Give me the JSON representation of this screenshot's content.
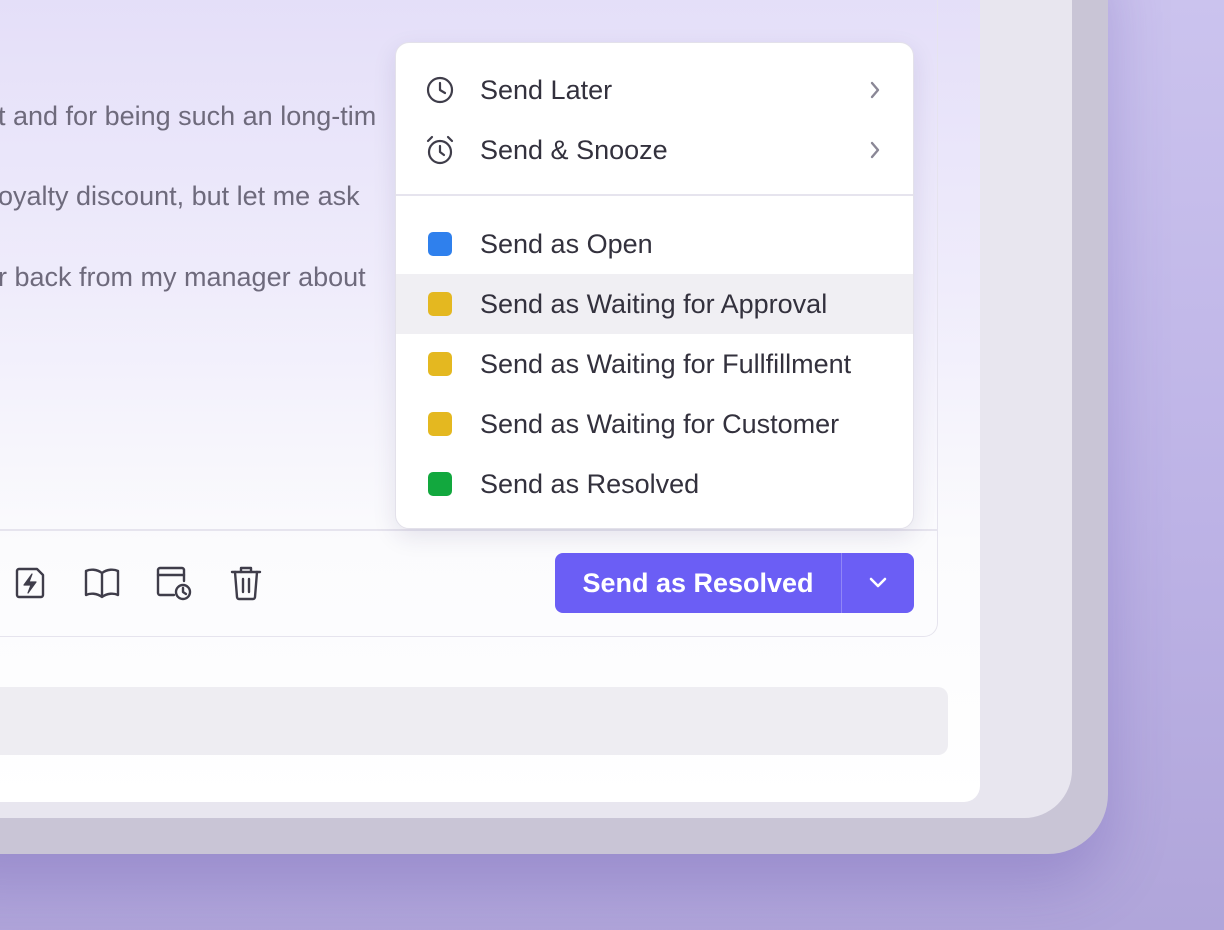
{
  "message": {
    "lines": [
      "t and for being such an long-tim",
      "oyalty discount, but let me ask",
      "r back from my manager about"
    ]
  },
  "toolbar": {
    "icons": [
      "lightning-snippet-icon",
      "knowledge-book-icon",
      "schedule-calendar-icon",
      "trash-icon"
    ]
  },
  "send_button": {
    "label": "Send as Resolved",
    "color": "#6b5ef5"
  },
  "dropdown": {
    "actions": [
      {
        "label": "Send Later",
        "icon": "clock-icon"
      },
      {
        "label": "Send & Snooze",
        "icon": "alarm-clock-icon"
      }
    ],
    "statuses": [
      {
        "label": "Send as Open",
        "color": "#2f80ed"
      },
      {
        "label": "Send as Waiting for Approval",
        "color": "#e4b820",
        "hovered": true
      },
      {
        "label": "Send as Waiting for Fullfillment",
        "color": "#e4b820"
      },
      {
        "label": "Send as Waiting for Customer",
        "color": "#e4b820"
      },
      {
        "label": "Send as Resolved",
        "color": "#12a83e"
      }
    ]
  }
}
